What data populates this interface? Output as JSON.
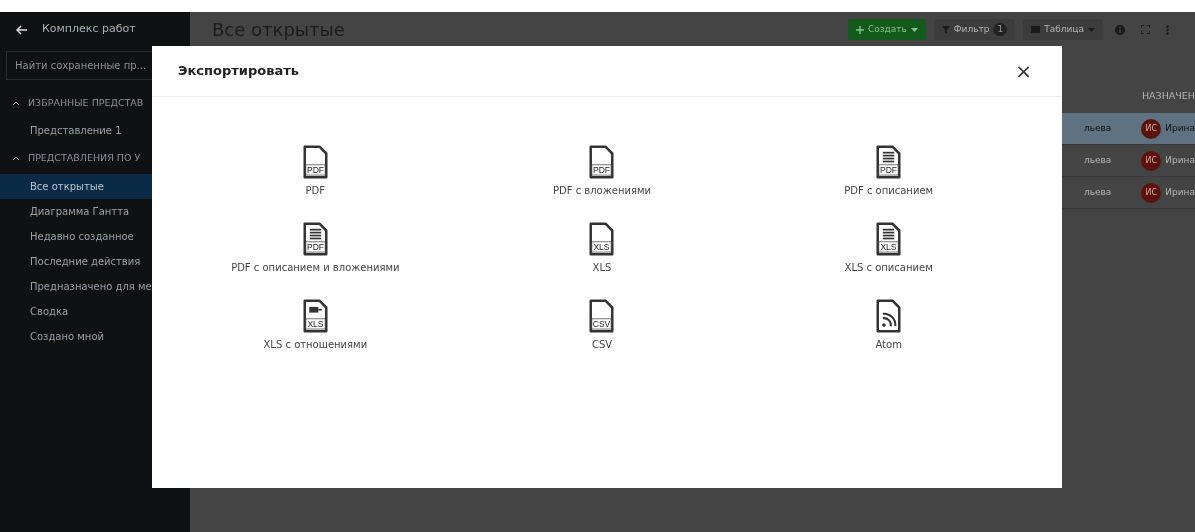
{
  "sidebar": {
    "back_title": "Комплекс работ",
    "search": {
      "placeholder": "Найти сохраненные пр..."
    },
    "sections": [
      {
        "title": "ИЗБРАННЫЕ ПРЕДСТАВ",
        "expanded": true,
        "items": [
          {
            "label": "Представление 1",
            "selected": false
          }
        ]
      },
      {
        "title": "ПРЕДСТАВЛЕНИЯ ПО У",
        "expanded": true,
        "items": [
          {
            "label": "Все открытые",
            "selected": true
          },
          {
            "label": "Диаграмма Гантта",
            "selected": false
          },
          {
            "label": "Недавно созданное",
            "selected": false
          },
          {
            "label": "Последние действия",
            "selected": false
          },
          {
            "label": "Предназначено для ме",
            "selected": false
          },
          {
            "label": "Сводка",
            "selected": false
          },
          {
            "label": "Создано мной",
            "selected": false
          }
        ]
      }
    ]
  },
  "header": {
    "title": "Все открытые",
    "create_button": "Создать",
    "filter_button": "Фильтр",
    "filter_count": "1",
    "view_button": "Таблица"
  },
  "table": {
    "column": "НАЗНАЧЕН",
    "rows": [
      {
        "column_1": "льева",
        "avatar": "ИС",
        "assignee": "Ирина",
        "selected": true
      },
      {
        "column_1": "льева",
        "avatar": "ИС",
        "assignee": "Ирина",
        "selected": false
      },
      {
        "column_1": "льева",
        "avatar": "ИС",
        "assignee": "Ирина",
        "selected": false
      }
    ]
  },
  "modal": {
    "title": "Экспортировать",
    "close": "×",
    "options": [
      {
        "label": "PDF",
        "kind": "plain",
        "tag": "PDF"
      },
      {
        "label": "PDF с вложениями",
        "kind": "plain",
        "tag": "PDF"
      },
      {
        "label": "PDF с описанием",
        "kind": "lines",
        "tag": "PDF"
      },
      {
        "label": "PDF с описанием и вложениями",
        "kind": "lines",
        "tag": "PDF"
      },
      {
        "label": "XLS",
        "kind": "plain",
        "tag": "XLS"
      },
      {
        "label": "XLS с описанием",
        "kind": "lines",
        "tag": "XLS"
      },
      {
        "label": "XLS с отношениями",
        "kind": "relation",
        "tag": "XLS"
      },
      {
        "label": "CSV",
        "kind": "plain",
        "tag": "CSV"
      },
      {
        "label": "Atom",
        "kind": "feed"
      }
    ]
  }
}
